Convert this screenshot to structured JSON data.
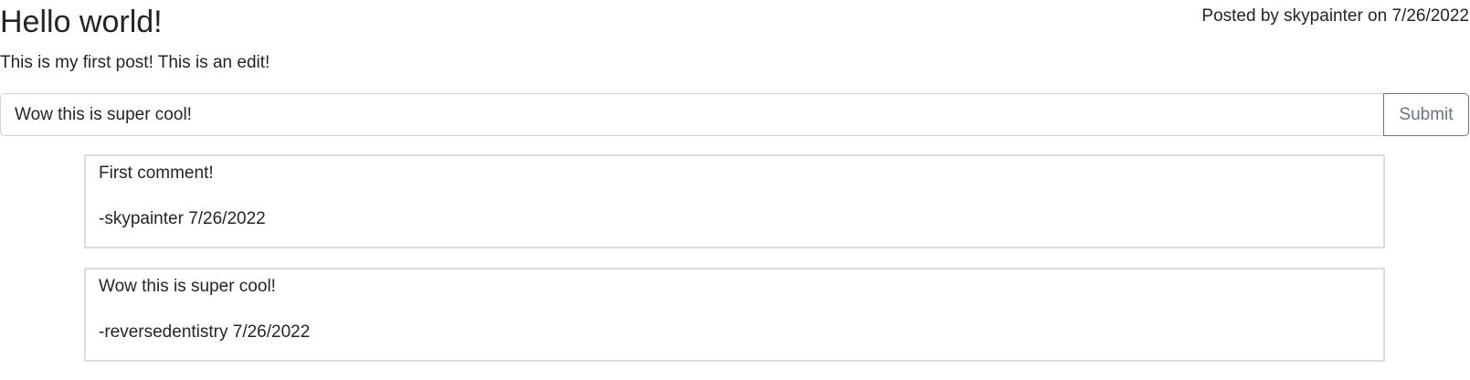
{
  "post": {
    "title": "Hello world!",
    "meta": "Posted by skypainter on 7/26/2022",
    "body": "This is my first post! This is an edit!"
  },
  "comment_form": {
    "input_value": "Wow this is super cool!",
    "submit_label": "Submit"
  },
  "comments": [
    {
      "text": "First comment!",
      "signature": "-skypainter 7/26/2022"
    },
    {
      "text": "Wow this is super cool!",
      "signature": "-reversedentistry 7/26/2022"
    }
  ]
}
